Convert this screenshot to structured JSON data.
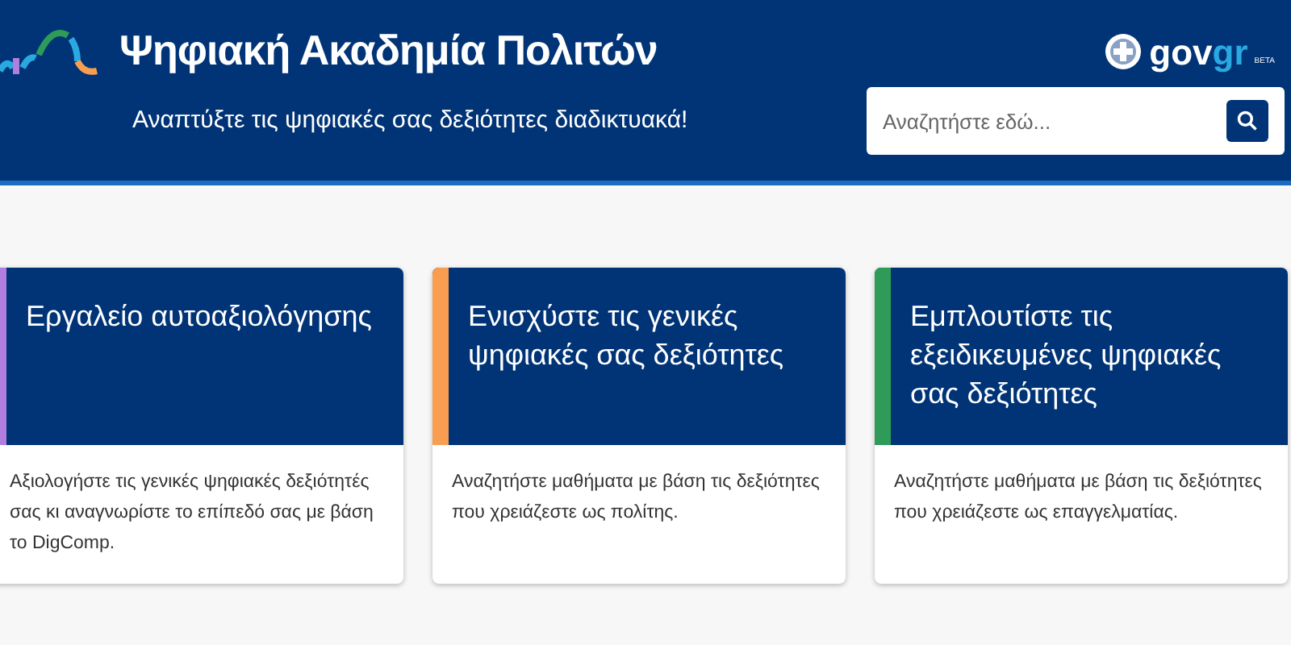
{
  "header": {
    "title": "Ψηφιακή Ακαδημία Πολιτών",
    "subtitle": "Αναπτύξτε τις ψηφιακές σας δεξιότητες διαδικτυακά!",
    "brand": {
      "name_dark": "gov",
      "name_light": "gr",
      "badge": "BETA"
    },
    "search": {
      "placeholder": "Αναζητήστε εδώ..."
    }
  },
  "cards": [
    {
      "title": "Εργαλείο αυτοαξιολόγησης",
      "description": "Αξιολογήστε τις γενικές ψηφιακές δεξιότητές σας κι αναγνωρίστε το επίπεδό σας με βάση το DigComp.",
      "color": "#b27ede"
    },
    {
      "title": "Ενισχύστε τις γενικές ψηφιακές σας δεξιότητες",
      "description": "Αναζητήστε μαθήματα με βάση τις δεξιότητες που χρειάζεστε ως πολίτης.",
      "color": "#f99e50"
    },
    {
      "title": "Εμπλουτίστε τις εξειδικευμένες ψηφιακές σας δεξιότητες",
      "description": "Αναζητήστε μαθήματα με βάση τις δεξιότητες που χρειάζεστε ως επαγγελματίας.",
      "color": "#2e9b59"
    }
  ]
}
